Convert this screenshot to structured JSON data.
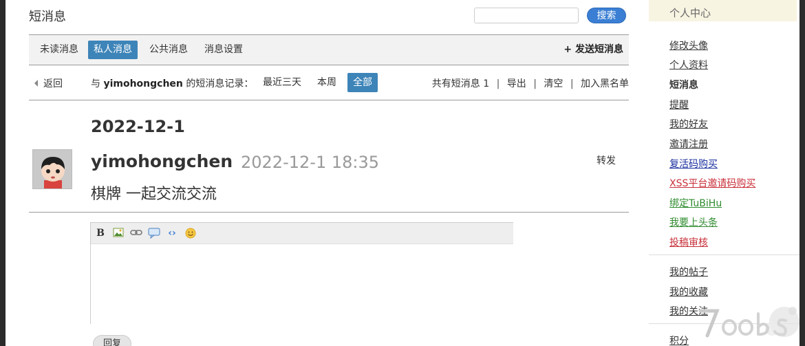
{
  "header": {
    "title": "短消息",
    "search_placeholder": "",
    "search_button": "搜索"
  },
  "tabs": [
    {
      "label": "未读消息",
      "active": false
    },
    {
      "label": "私人消息",
      "active": true
    },
    {
      "label": "公共消息",
      "active": false
    },
    {
      "label": "消息设置",
      "active": false
    }
  ],
  "send_message": "+ 发送短消息",
  "filter_row": {
    "back_label": "返回",
    "record_prefix": "与",
    "record_user": "yimohongchen",
    "record_suffix": "的短消息记录：",
    "filters": [
      "最近三天",
      "本周",
      "全部"
    ],
    "active_filter": "全部",
    "total_label": "共有短消息",
    "total_count": "1",
    "export": "导出",
    "clear": "清空",
    "blacklist": "加入黑名单"
  },
  "conversation": {
    "date_heading": "2022-12-1",
    "message": {
      "user": "yimohongchen",
      "time": "2022-12-1 18:35",
      "body": "棋牌 一起交流交流",
      "forward_label": "转发"
    }
  },
  "editor": {
    "toolbar_icons": [
      "bold-icon",
      "image-icon",
      "link-icon",
      "quote-icon",
      "code-icon",
      "smiley-icon"
    ],
    "bold_glyph": "B",
    "code_glyph": "‹›",
    "reply_button": "回复"
  },
  "sidebar": {
    "heading": "个人中心",
    "items": [
      {
        "label": "修改头像",
        "color": "#333333"
      },
      {
        "label": "个人资料",
        "color": "#333333"
      },
      {
        "label": "短消息",
        "color": "#333333",
        "current": true
      },
      {
        "label": "提醒",
        "color": "#333333"
      },
      {
        "label": "我的好友",
        "color": "#333333"
      },
      {
        "label": "邀请注册",
        "color": "#333333"
      },
      {
        "label": "复活码购买",
        "color": "#1a2f9e"
      },
      {
        "label": "XSS平台邀请码购买",
        "color": "#c8303a"
      },
      {
        "label": "绑定TuBiHu",
        "color": "#2e8b2e"
      },
      {
        "label": "我要上头条",
        "color": "#2e8b2e"
      },
      {
        "label": "投稿审核",
        "color": "#c8303a"
      },
      {
        "label": "我的帖子",
        "color": "#333333"
      },
      {
        "label": "我的收藏",
        "color": "#333333"
      },
      {
        "label": "我的关注",
        "color": "#333333"
      },
      {
        "label": "积分",
        "color": "#333333"
      }
    ]
  },
  "colors": {
    "accent": "#3d84b8",
    "search_button": "#3b7fd4",
    "sidebar_header_bg": "#f8f4e2"
  }
}
